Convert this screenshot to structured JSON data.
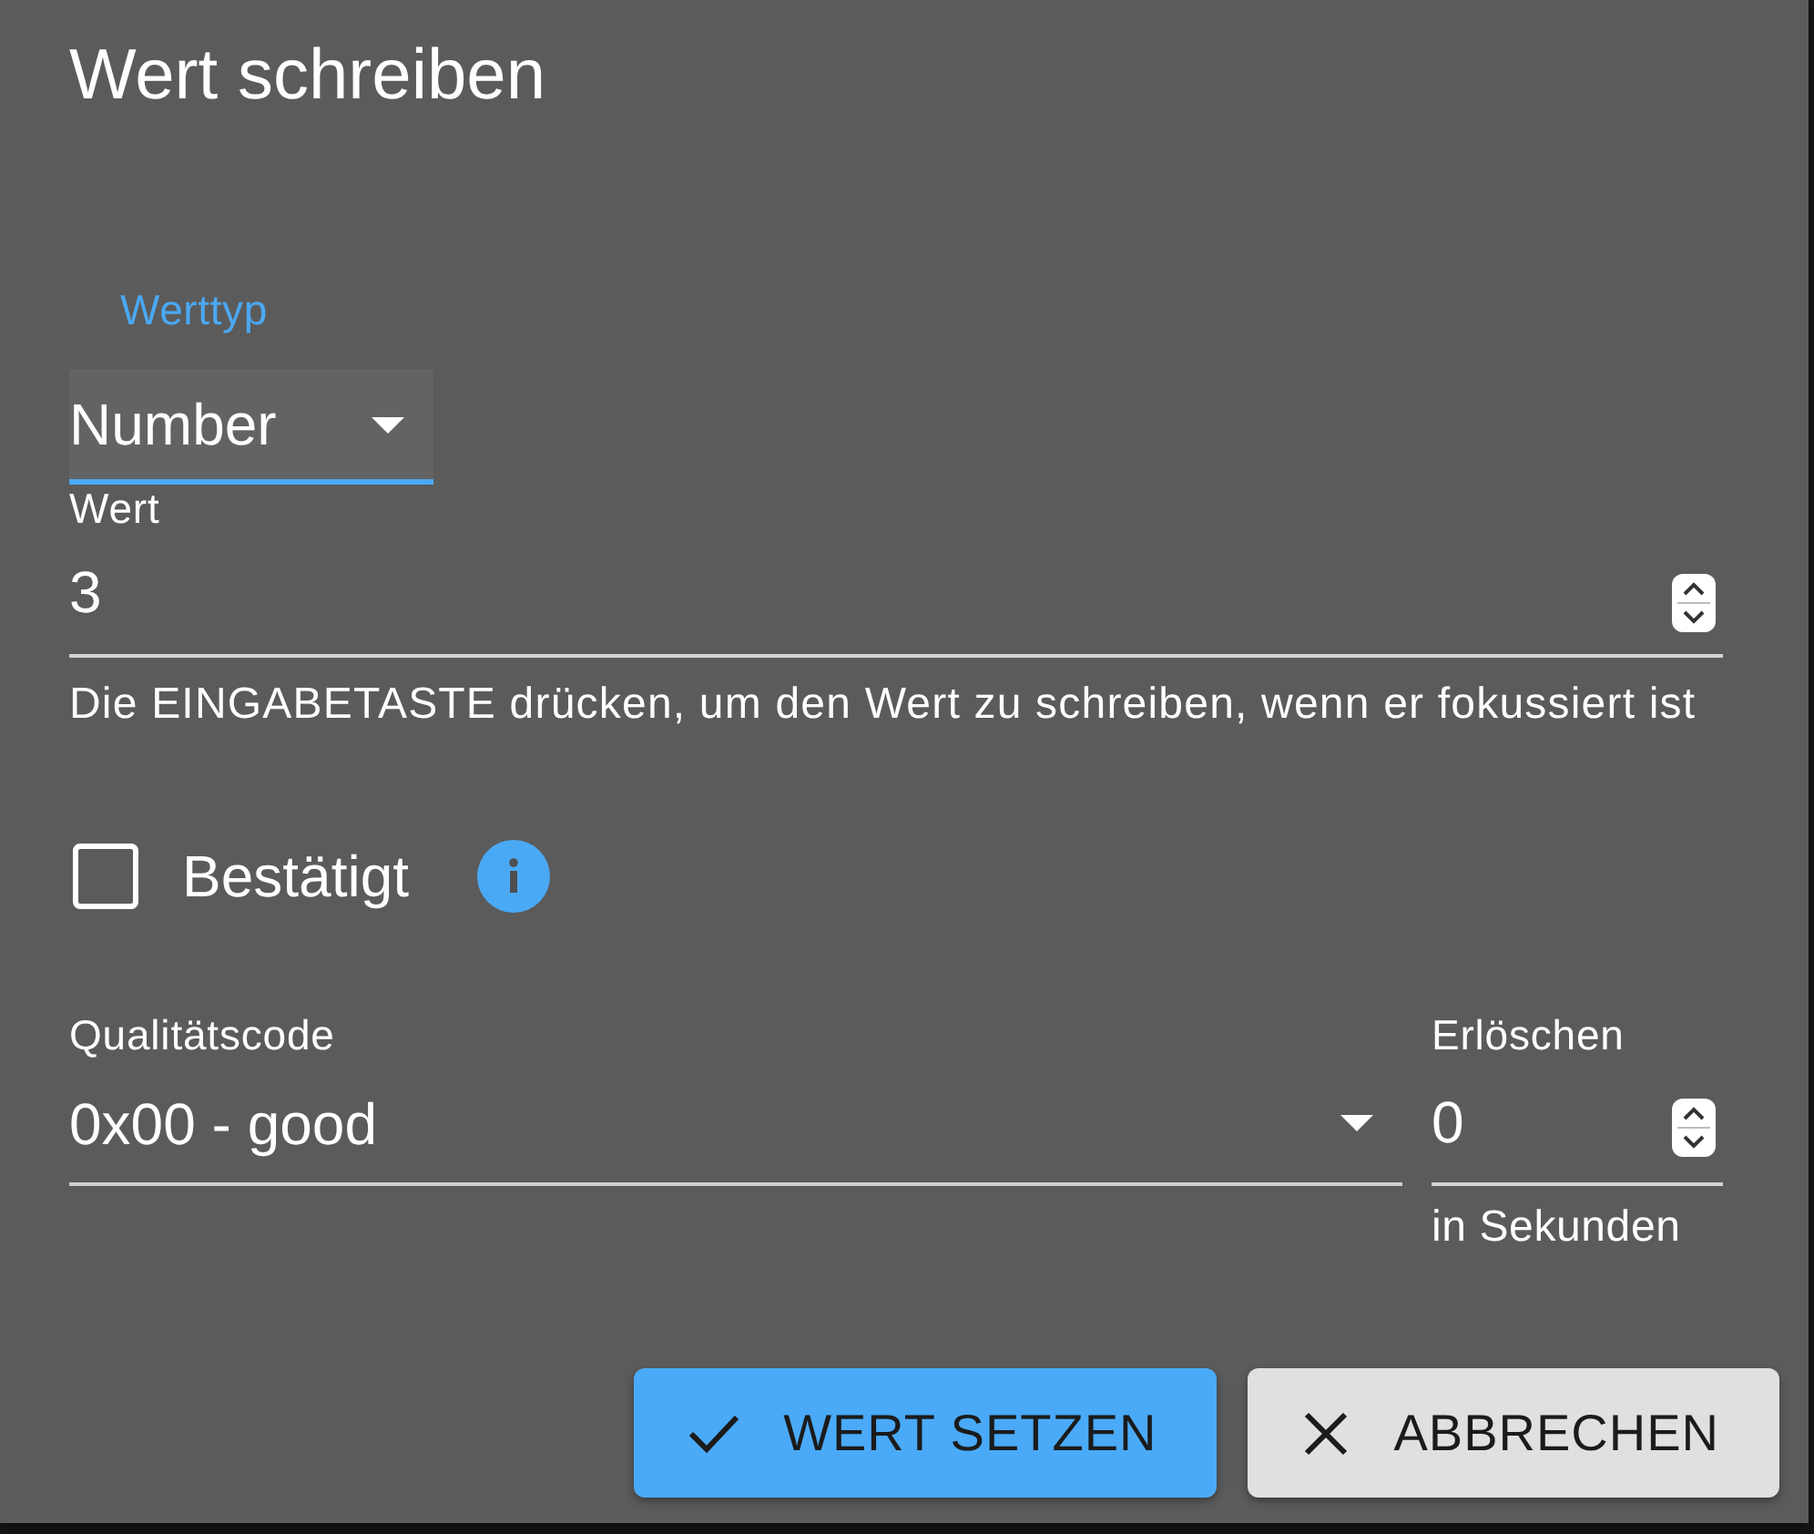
{
  "dialog": {
    "title": "Wert schreiben",
    "value_type": {
      "label": "Werttyp",
      "value": "Number",
      "focused": true
    },
    "value": {
      "label": "Wert",
      "value": "3",
      "helper": "Die EINGABETASTE drücken, um den Wert zu schreiben, wenn er fokussiert ist"
    },
    "acknowledged": {
      "label": "Bestätigt",
      "checked": false
    },
    "quality_code": {
      "label": "Qualitätscode",
      "value": "0x00 - good"
    },
    "expire": {
      "label": "Erlöschen",
      "value": "0",
      "helper": "in Sekunden"
    },
    "buttons": [
      {
        "label": "WERT SETZEN",
        "kind": "primary"
      },
      {
        "label": "ABBRECHEN",
        "kind": "cancel"
      }
    ]
  }
}
